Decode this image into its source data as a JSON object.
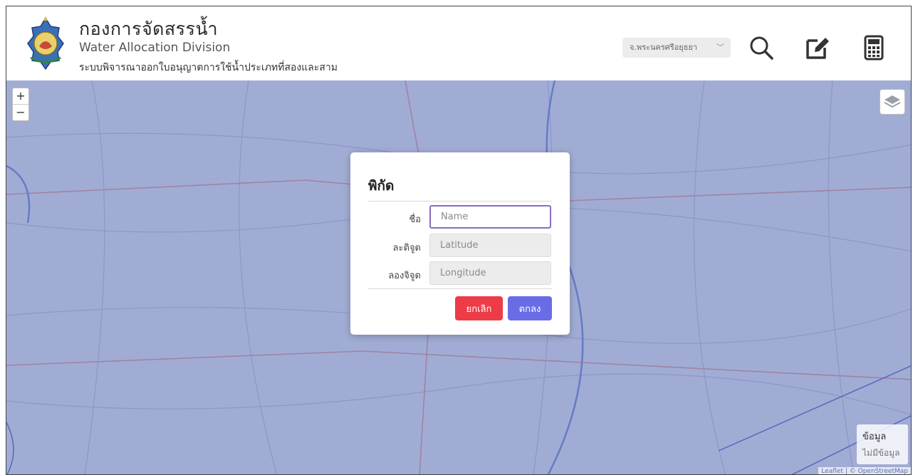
{
  "header": {
    "title_th": "กองการจัดสรรน้ำ",
    "title_en": "Water Allocation Division",
    "subtitle": "ระบบพิจารณาออกใบอนุญาตการใช้น้ำประเภทที่สองและสาม",
    "province_select": "จ.พระนครศรีอยุธยา",
    "icons": [
      "search-icon",
      "edit-icon",
      "calculator-icon"
    ]
  },
  "map": {
    "zoom_in": "+",
    "zoom_out": "−",
    "info_title": "ข้อมูล",
    "info_value": "ไม่มีข้อมูล",
    "attribution": "Leaflet | © OpenStreetMap"
  },
  "modal": {
    "title": "พิกัด",
    "fields": [
      {
        "label": "ชื่อ",
        "placeholder": "Name"
      },
      {
        "label": "ละติจูด",
        "placeholder": "Latitude"
      },
      {
        "label": "ลองจิจูด",
        "placeholder": "Longitude"
      }
    ],
    "cancel_label": "ยกเลิก",
    "ok_label": "ตกลง"
  },
  "colors": {
    "map_overlay": "#4054aa",
    "cancel_button": "#ee3b48",
    "ok_button": "#6a6ce6",
    "focus_border": "#8a6cc0"
  }
}
